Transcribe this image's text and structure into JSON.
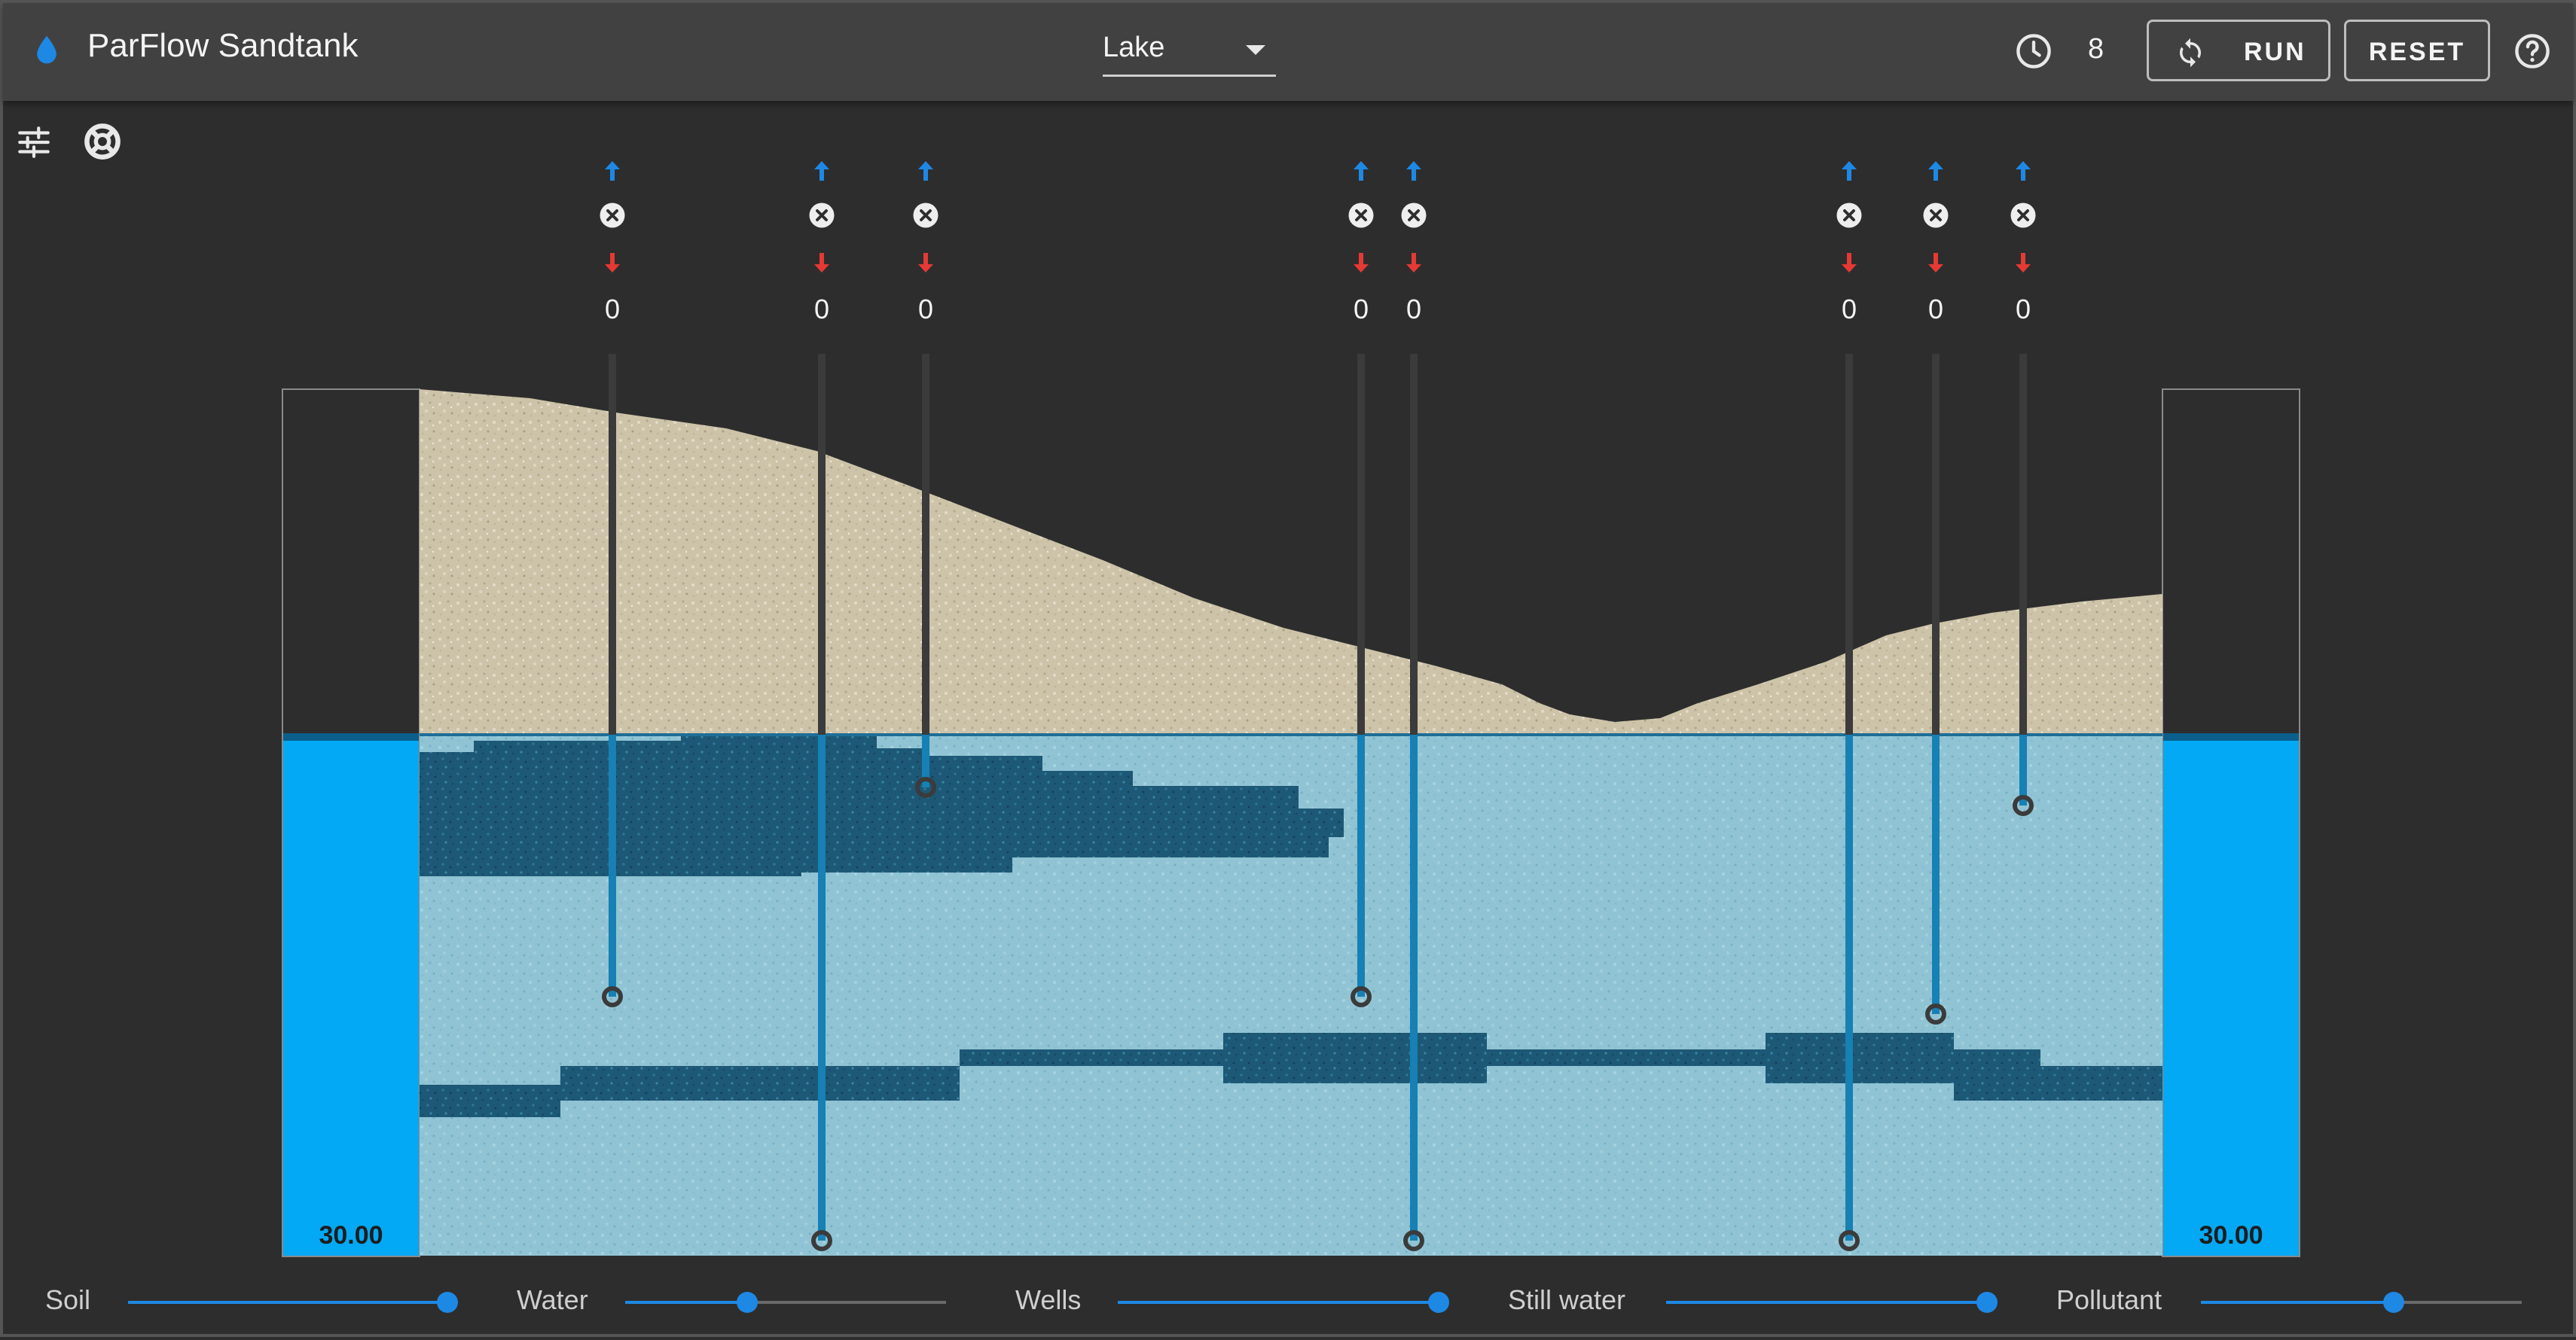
{
  "app": {
    "title": "ParFlow Sandtank"
  },
  "scenario": {
    "value": "Lake"
  },
  "toolbar": {
    "time_count": "8",
    "run_label": "RUN",
    "reset_label": "RESET"
  },
  "icons": {
    "app": "water-drop-icon",
    "clock": "clock-icon",
    "run": "refresh-icon",
    "help": "help-circle-icon",
    "settings": "sliders-icon",
    "lifebuoy": "lifebuoy-icon"
  },
  "tanks": {
    "left_value": "30.00",
    "right_value": "30.00"
  },
  "wells": [
    {
      "value": "0"
    },
    {
      "value": "0"
    },
    {
      "value": "0"
    },
    {
      "value": "0"
    },
    {
      "value": "0"
    },
    {
      "value": "0"
    },
    {
      "value": "0"
    },
    {
      "value": "0"
    }
  ],
  "sliders": [
    {
      "label": "Soil",
      "level": 1.0
    },
    {
      "label": "Water",
      "level": 0.38
    },
    {
      "label": "Wells",
      "level": 1.0
    },
    {
      "label": "Still water",
      "level": 1.0
    },
    {
      "label": "Pollutant",
      "level": 0.6
    }
  ],
  "colors": {
    "accent": "#1e88e5",
    "tank_water": "#03a9f4",
    "wet_soil": "#93c7d6",
    "clay": "#1e5a78",
    "sand": "#cdc3a8",
    "bad": "#e53935"
  }
}
